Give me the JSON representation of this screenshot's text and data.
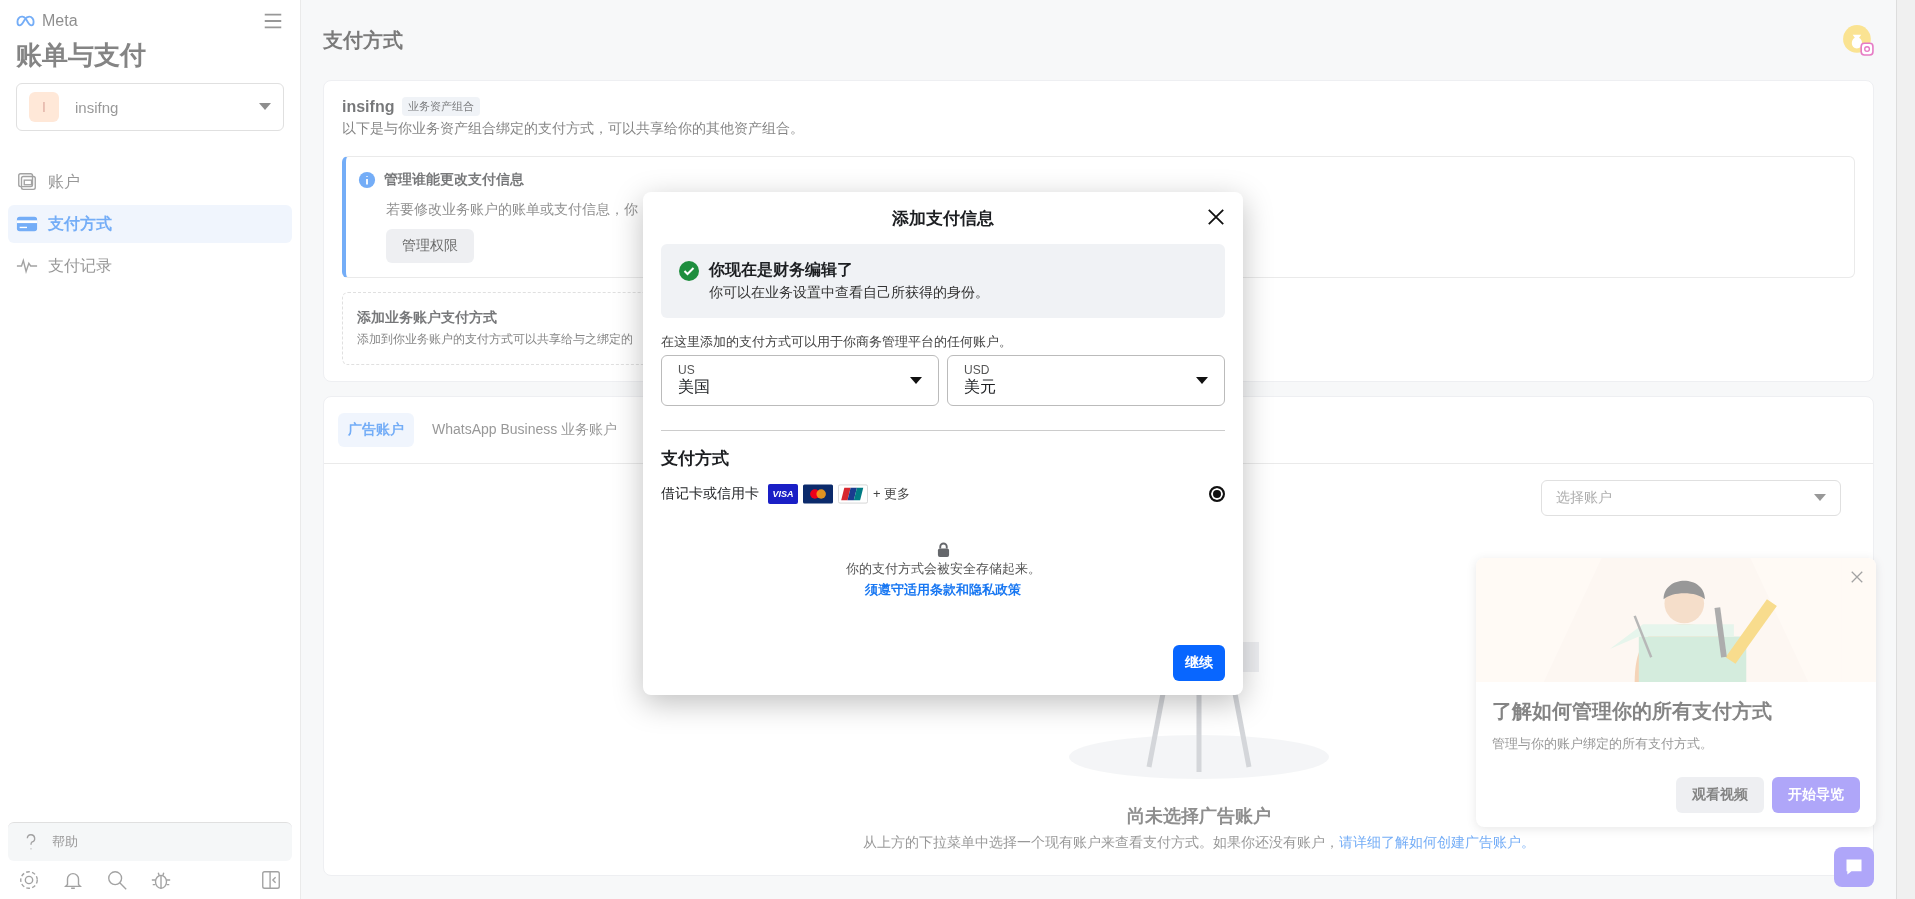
{
  "sidebar": {
    "logo_text": "Meta",
    "title": "账单与支付",
    "account": {
      "initial": "I",
      "name": "insifng"
    },
    "items": [
      {
        "label": "账户",
        "selected": false
      },
      {
        "label": "支付方式",
        "selected": true
      },
      {
        "label": "支付记录",
        "selected": false
      }
    ],
    "help": "帮助"
  },
  "page": {
    "title": "支付方式"
  },
  "portfolio_card": {
    "name": "insifng",
    "badge": "业务资产组合",
    "description": "以下是与你业务资产组合绑定的支付方式，可以共享给你的其他资产组合。",
    "notice": {
      "title": "管理谁能更改支付信息",
      "text": "若要修改业务账户的账单或支付信息，你",
      "button": "管理权限"
    },
    "add": {
      "title": "添加业务账户支付方式",
      "text": "添加到你业务账户的支付方式可以共享给与之绑定的"
    }
  },
  "accounts_card": {
    "tabs": [
      {
        "label": "广告账户",
        "selected": true
      },
      {
        "label": "WhatsApp Business 业务账户",
        "selected": false
      }
    ],
    "select_placeholder": "选择账户",
    "empty_title": "尚未选择广告账户",
    "empty_text": "从上方的下拉菜单中选择一个现有账户来查看支付方式。如果你还没有账户，",
    "empty_link": "请详细了解如何创建广告账户。"
  },
  "tour_card": {
    "title": "了解如何管理你的所有支付方式",
    "text": "管理与你的账户绑定的所有支付方式。",
    "buttons": [
      {
        "label": "观看视频",
        "kind": "secondary"
      },
      {
        "label": "开始导览",
        "kind": "primary"
      }
    ]
  },
  "dialog": {
    "title": "添加支付信息",
    "success": {
      "title": "你现在是财务编辑了",
      "text": "你可以在业务设置中查看自己所获得的身份。"
    },
    "hint": "在这里添加的支付方式可以用于你商务管理平台的任何账户。",
    "selects": [
      {
        "label": "US",
        "value": "美国"
      },
      {
        "label": "USD",
        "value": "美元"
      }
    ],
    "section_title": "支付方式",
    "options": [
      {
        "label": "借记卡或信用卡",
        "cards": [
          {
            "kind": "visa",
            "text": "VISA"
          },
          {
            "kind": "mastercard"
          },
          {
            "kind": "unionpay"
          }
        ],
        "more": "+ 更多",
        "selected": true
      }
    ],
    "secure_text": "你的支付方式会被安全存储起来。",
    "terms_link": "须遵守适用条款和隐私政策",
    "button": "继续"
  }
}
